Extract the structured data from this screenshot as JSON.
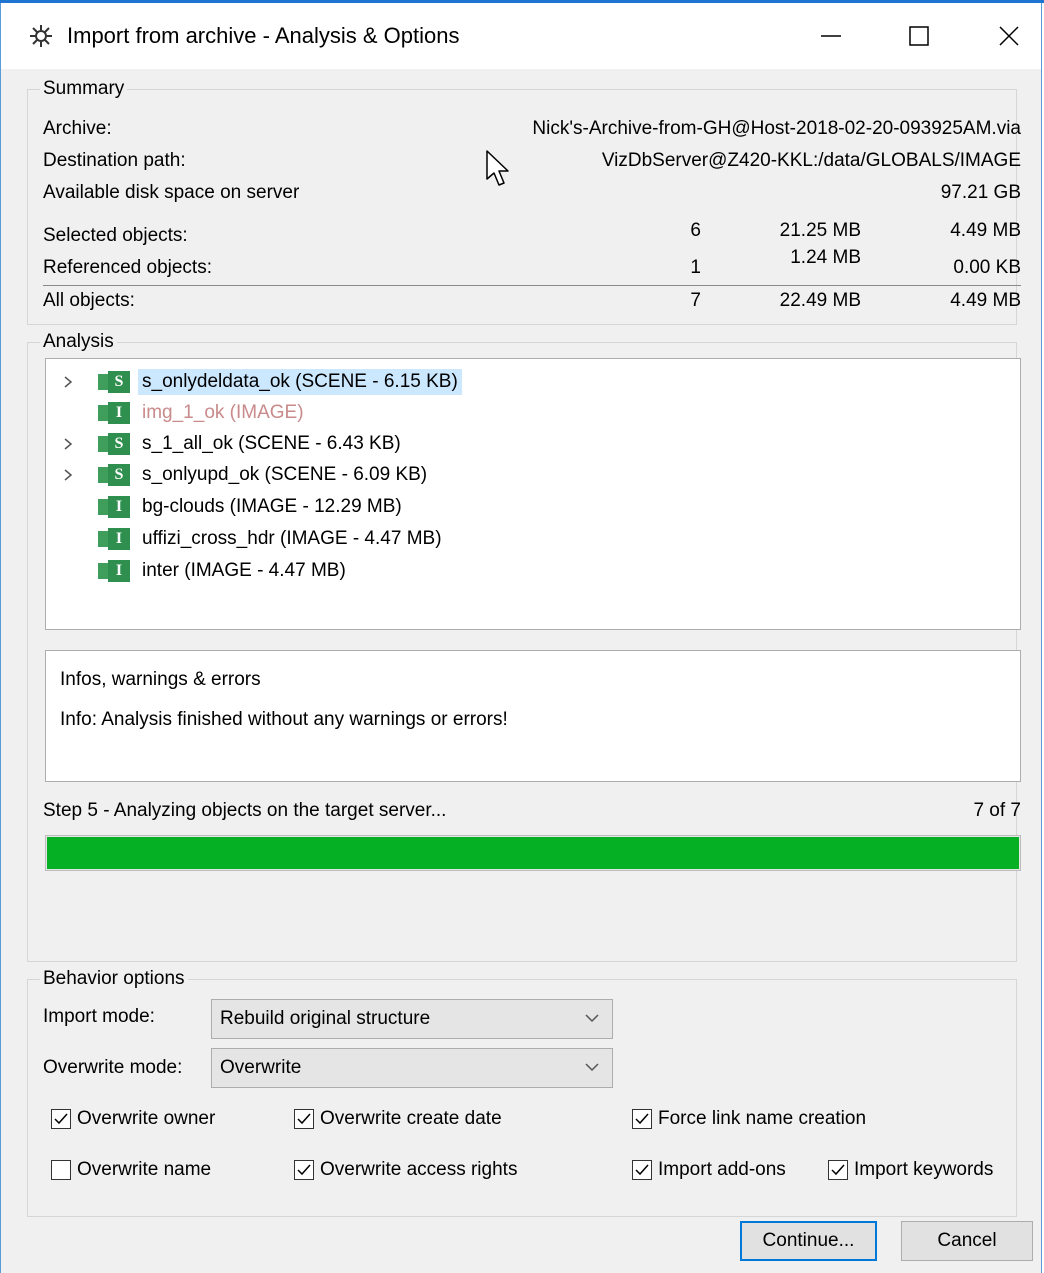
{
  "window": {
    "title": "Import from archive - Analysis & Options",
    "icons": {
      "app": "gear-icon",
      "minimize": "minimize-icon",
      "maximize": "maximize-icon",
      "close": "close-icon"
    }
  },
  "summary": {
    "legend": "Summary",
    "archive_label": "Archive:",
    "archive_value": "Nick's-Archive-from-GH@Host-2018-02-20-093925AM.via",
    "destination_label": "Destination path:",
    "destination_value": "VizDbServer@Z420-KKL:/data/GLOBALS/IMAGE",
    "disk_label": "Available disk space on server",
    "disk_value": "97.21 GB",
    "rows": [
      {
        "label": "Selected objects:",
        "count": "6",
        "size1": "21.25 MB",
        "size2": "4.49 MB"
      },
      {
        "label": "Referenced objects:",
        "count": "1",
        "size1": "1.24 MB",
        "size2": "0.00 KB"
      },
      {
        "label": "All objects:",
        "count": "7",
        "size1": "22.49 MB",
        "size2": "4.49 MB"
      }
    ]
  },
  "analysis": {
    "legend": "Analysis",
    "tree": [
      {
        "label": "s_onlydeldata_ok (SCENE - 6.15 KB)",
        "type_letter": "S",
        "expandable": true,
        "selected": true,
        "dim": false
      },
      {
        "label": "img_1_ok (IMAGE)",
        "type_letter": "I",
        "expandable": false,
        "selected": false,
        "dim": true
      },
      {
        "label": "s_1_all_ok (SCENE - 6.43 KB)",
        "type_letter": "S",
        "expandable": true,
        "selected": false,
        "dim": false
      },
      {
        "label": "s_onlyupd_ok (SCENE - 6.09 KB)",
        "type_letter": "S",
        "expandable": true,
        "selected": false,
        "dim": false
      },
      {
        "label": "bg-clouds (IMAGE - 12.29 MB)",
        "type_letter": "I",
        "expandable": false,
        "selected": false,
        "dim": false
      },
      {
        "label": "uffizi_cross_hdr (IMAGE - 4.47 MB)",
        "type_letter": "I",
        "expandable": false,
        "selected": false,
        "dim": false
      },
      {
        "label": "inter (IMAGE - 4.47 MB)",
        "type_letter": "I",
        "expandable": false,
        "selected": false,
        "dim": false
      }
    ],
    "info_title": "Infos, warnings & errors",
    "info_message": "Info: Analysis finished without any warnings or errors!",
    "step_text": "Step 5 - Analyzing objects on the target server...",
    "step_count": "7 of 7",
    "progress": 1.0,
    "progress_color": "#06b025"
  },
  "behavior": {
    "legend": "Behavior options",
    "import_mode_label": "Import mode:",
    "import_mode_value": "Rebuild original structure",
    "overwrite_mode_label": "Overwrite mode:",
    "overwrite_mode_value": "Overwrite",
    "checkboxes": [
      {
        "label": "Overwrite owner",
        "checked": true
      },
      {
        "label": "Overwrite create date",
        "checked": true
      },
      {
        "label": "Force link name creation",
        "checked": true
      },
      {
        "label": "Overwrite name",
        "checked": false
      },
      {
        "label": "Overwrite access rights",
        "checked": true
      },
      {
        "label": "Import add-ons",
        "checked": true
      },
      {
        "label": "Import keywords",
        "checked": true
      }
    ]
  },
  "buttons": {
    "continue": "Continue...",
    "cancel": "Cancel"
  },
  "colors": {
    "accent": "#0078d7",
    "selection": "#cce8ff",
    "object_icon": "#2f8f4e"
  }
}
